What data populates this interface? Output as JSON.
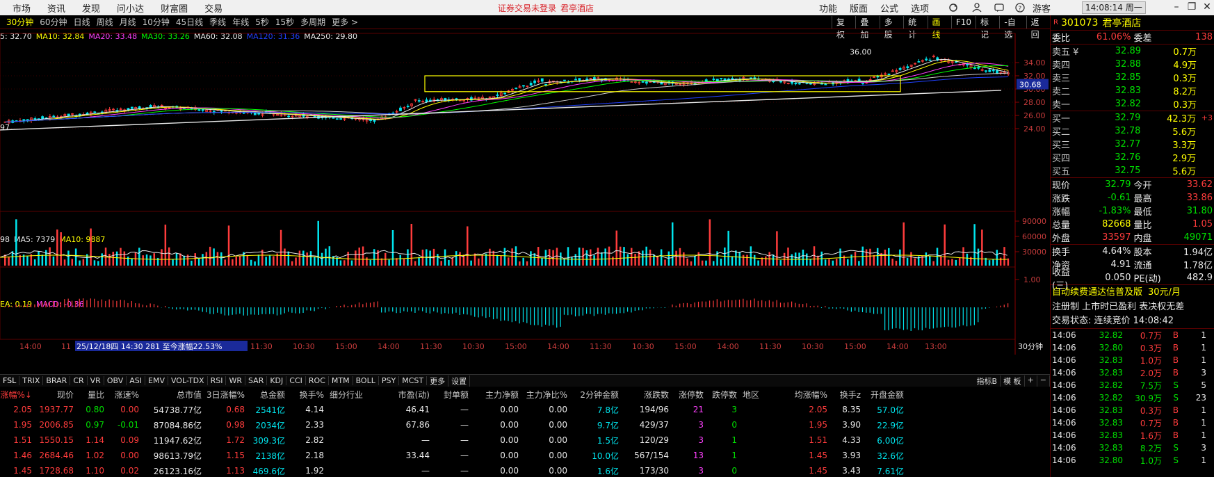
{
  "top": {
    "menu": [
      "市场",
      "资讯",
      "发现",
      "问小达",
      "财富圈",
      "交易"
    ],
    "notice": "证券交易未登录",
    "notice_stock": "君亭酒店",
    "right_menu": [
      "功能",
      "版面",
      "公式",
      "选项"
    ],
    "guest": "游客",
    "clock": "14:08:14 周一"
  },
  "periods": [
    "30分钟",
    "60分钟",
    "日线",
    "周线",
    "月线",
    "10分钟",
    "45日线",
    "季线",
    "年线",
    "5秒",
    "15秒",
    "多周期",
    "更多 >"
  ],
  "active_period": "30分钟",
  "tools": [
    "复权",
    "叠加",
    "多股",
    "统计",
    "画线",
    "F10",
    "标记",
    "-自选",
    "返回"
  ],
  "ma_legend": [
    {
      "t": "5: 32.70",
      "c": "#e8e8e8"
    },
    {
      "t": "MA10: 32.84",
      "c": "#ffff00"
    },
    {
      "t": "MA20: 33.48",
      "c": "#ff40ff"
    },
    {
      "t": "MA30: 33.26",
      "c": "#00ff00"
    },
    {
      "t": "MA60: 32.08",
      "c": "#e8e8e8"
    },
    {
      "t": "MA120: 31.36",
      "c": "#2040ff"
    },
    {
      "t": "MA250: 29.80",
      "c": "#e8e8e8"
    }
  ],
  "vol_legend": [
    {
      "t": "98",
      "c": "#e8e8e8"
    },
    {
      "t": "MA5: 7379",
      "c": "#e8e8e8"
    },
    {
      "t": "MA10: 9887",
      "c": "#ffff00"
    }
  ],
  "macd_legend": [
    {
      "t": "EA: 0.19",
      "c": "#ffff00"
    },
    {
      "t": "MACD: -0.36",
      "c": "#ff40ff"
    }
  ],
  "price_axis": [
    "34.00",
    "32.00",
    "30.00",
    "28.00",
    "26.00",
    "24.00"
  ],
  "price_marker": "30.68",
  "high_label": "36.00",
  "low_label": "97",
  "vol_axis": [
    "90000",
    "60000",
    "30000"
  ],
  "macd_axis": "1.00",
  "time_axis": [
    "14:00",
    "11",
    "25/12/18四 14:30 281 至今涨幅22.53%",
    "11:30",
    "10:30",
    "15:00",
    "14:00",
    "11:30",
    "10:30",
    "15:00",
    "14:00",
    "11:30",
    "10:30",
    "15:00",
    "14:00",
    "11:30",
    "10:30",
    "15:00",
    "14:00",
    "13:00"
  ],
  "time_axis_right": "30分钟",
  "indicators": [
    "FSL",
    "TRIX",
    "BRAR",
    "CR",
    "VR",
    "OBV",
    "ASI",
    "EMV",
    "VOL-TDX",
    "RSI",
    "WR",
    "SAR",
    "KDJ",
    "CCI",
    "ROC",
    "MTM",
    "BOLL",
    "PSY",
    "MCST",
    "更多",
    "设置"
  ],
  "indicators_right": [
    "指标B",
    "模 板",
    "+",
    "−"
  ],
  "table": {
    "headers": [
      "涨幅%↓",
      "现价",
      "量比",
      "涨速%",
      "总市值",
      "3日涨幅%",
      "总金额",
      "换手%",
      "细分行业",
      "市盈(动)",
      "封单额",
      "主力净额",
      "主力净比%",
      "2分钟金额",
      "涨跌数",
      "涨停数",
      "跌停数",
      "地区",
      "均涨幅%",
      "换手z",
      "开盘金额"
    ],
    "rows": [
      [
        "2.05",
        "1937.77",
        "0.80",
        "0.00",
        "54738.77亿",
        "0.68",
        "2541亿",
        "4.14",
        "",
        "46.41",
        "—",
        "0.00",
        "0.00",
        "7.8亿",
        "194/96",
        "21",
        "3",
        "",
        "2.05",
        "8.35",
        "57.0亿"
      ],
      [
        "1.95",
        "2006.85",
        "0.97",
        "-0.01",
        "87084.86亿",
        "0.98",
        "2034亿",
        "2.33",
        "",
        "67.86",
        "—",
        "0.00",
        "0.00",
        "9.7亿",
        "429/37",
        "3",
        "0",
        "",
        "1.95",
        "3.90",
        "22.9亿"
      ],
      [
        "1.51",
        "1550.15",
        "1.14",
        "0.09",
        "11947.62亿",
        "1.72",
        "309.3亿",
        "2.82",
        "",
        "—",
        "—",
        "0.00",
        "0.00",
        "1.5亿",
        "120/29",
        "3",
        "1",
        "",
        "1.51",
        "4.33",
        "6.00亿"
      ],
      [
        "1.46",
        "2684.46",
        "1.02",
        "0.00",
        "98613.79亿",
        "1.15",
        "2138亿",
        "2.18",
        "",
        "33.44",
        "—",
        "0.00",
        "0.00",
        "10.0亿",
        "567/154",
        "13",
        "1",
        "",
        "1.45",
        "3.93",
        "32.6亿"
      ],
      [
        "1.45",
        "1728.68",
        "1.10",
        "0.02",
        "26123.16亿",
        "1.13",
        "469.6亿",
        "1.92",
        "",
        "—",
        "—",
        "0.00",
        "0.00",
        "1.6亿",
        "173/30",
        "3",
        "0",
        "",
        "1.45",
        "3.43",
        "7.61亿"
      ]
    ]
  },
  "panel": {
    "flag": "R",
    "code": "301073",
    "name": "君亭酒店",
    "weibi_label": "委比",
    "weibi": "61.06%",
    "weicha_label": "委差",
    "weicha": "138",
    "asks": [
      {
        "l": "卖五 ¥",
        "p": "32.89",
        "v": "0.7万"
      },
      {
        "l": "卖四",
        "p": "32.88",
        "v": "4.9万"
      },
      {
        "l": "卖三",
        "p": "32.85",
        "v": "0.3万"
      },
      {
        "l": "卖二",
        "p": "32.83",
        "v": "8.2万"
      },
      {
        "l": "卖一",
        "p": "32.82",
        "v": "0.3万"
      }
    ],
    "bids": [
      {
        "l": "买一",
        "p": "32.79",
        "v": "42.3万",
        "x": "+3"
      },
      {
        "l": "买二",
        "p": "32.78",
        "v": "5.6万",
        "x": ""
      },
      {
        "l": "买三",
        "p": "32.77",
        "v": "3.3万",
        "x": ""
      },
      {
        "l": "买四",
        "p": "32.76",
        "v": "2.9万",
        "x": ""
      },
      {
        "l": "买五",
        "p": "32.75",
        "v": "5.6万",
        "x": ""
      }
    ],
    "stats": [
      [
        {
          "k": "现价",
          "v": "32.79",
          "c": "green"
        },
        {
          "k": "今开",
          "v": "33.62",
          "c": "red"
        }
      ],
      [
        {
          "k": "涨跌",
          "v": "-0.61",
          "c": "green"
        },
        {
          "k": "最高",
          "v": "33.86",
          "c": "red"
        }
      ],
      [
        {
          "k": "涨幅",
          "v": "-1.83%",
          "c": "green"
        },
        {
          "k": "最低",
          "v": "31.80",
          "c": "green"
        }
      ],
      [
        {
          "k": "总量",
          "v": "82668",
          "c": "yel"
        },
        {
          "k": "量比",
          "v": "1.05",
          "c": "red"
        }
      ],
      [
        {
          "k": "外盘",
          "v": "33597",
          "c": "red"
        },
        {
          "k": "内盘",
          "v": "49071",
          "c": "green"
        }
      ]
    ],
    "stats2": [
      [
        {
          "k": "换手",
          "v": "4.64%",
          "c": "wht"
        },
        {
          "k": "股本",
          "v": "1.94亿",
          "c": "wht"
        }
      ],
      [
        {
          "k": "净资",
          "v": "4.91",
          "c": "wht"
        },
        {
          "k": "流通",
          "v": "1.78亿",
          "c": "wht"
        }
      ],
      [
        {
          "k": "收益(三)",
          "v": "0.050",
          "c": "wht"
        },
        {
          "k": "PE(动)",
          "v": "482.9",
          "c": "wht"
        }
      ]
    ],
    "promo": "自动续费通达信普及版",
    "promo_price": "30元/月",
    "info1": "注册制 上市时已盈利 表决权无差",
    "info2": "交易状态: 连续竞价 14:08:42",
    "ticks": [
      {
        "t": "14:06",
        "p": "32.82",
        "v": "0.7万",
        "bs": "B",
        "n": "1"
      },
      {
        "t": "14:06",
        "p": "32.80",
        "v": "0.3万",
        "bs": "B",
        "n": "1"
      },
      {
        "t": "14:06",
        "p": "32.83",
        "v": "1.0万",
        "bs": "B",
        "n": "1"
      },
      {
        "t": "14:06",
        "p": "32.83",
        "v": "2.0万",
        "bs": "B",
        "n": "3"
      },
      {
        "t": "14:06",
        "p": "32.82",
        "v": "7.5万",
        "bs": "S",
        "n": "5"
      },
      {
        "t": "14:06",
        "p": "32.82",
        "v": "30.9万",
        "bs": "S",
        "n": "23"
      },
      {
        "t": "14:06",
        "p": "32.83",
        "v": "0.3万",
        "bs": "B",
        "n": "1"
      },
      {
        "t": "14:06",
        "p": "32.83",
        "v": "0.7万",
        "bs": "B",
        "n": "1"
      },
      {
        "t": "14:06",
        "p": "32.83",
        "v": "1.6万",
        "bs": "B",
        "n": "1"
      },
      {
        "t": "14:06",
        "p": "32.83",
        "v": "8.2万",
        "bs": "S",
        "n": "3"
      },
      {
        "t": "14:06",
        "p": "32.80",
        "v": "1.0万",
        "bs": "S",
        "n": "1"
      }
    ]
  }
}
